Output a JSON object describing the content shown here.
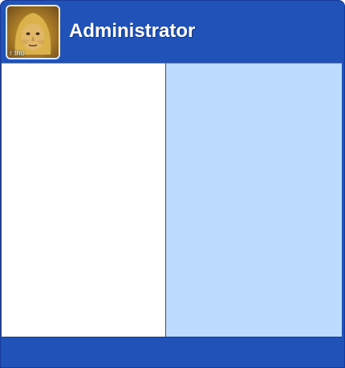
{
  "header": {
    "user_name": "Administrator",
    "avatar": {
      "icon": "user-photo",
      "caption": "r tho"
    }
  },
  "left_pane": {
    "items": []
  },
  "right_pane": {
    "items": []
  },
  "footer": {
    "buttons": []
  },
  "colors": {
    "accent": "#2152b8",
    "left_pane_bg": "#ffffff",
    "right_pane_bg": "#bcdbff"
  }
}
